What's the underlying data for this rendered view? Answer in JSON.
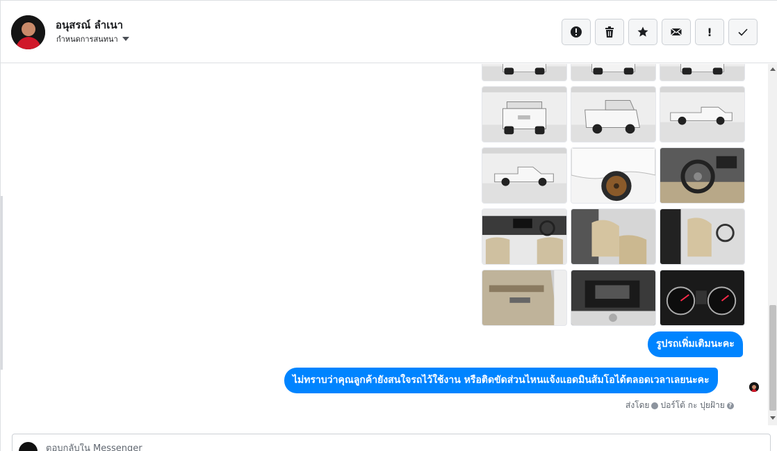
{
  "header": {
    "contact_name": "อนุสรณ์ ลำเนา",
    "assign_label": "กำหนดการสนทนา"
  },
  "toolbar": {
    "buttons": [
      {
        "icon": "alert-circle-icon",
        "label": ""
      },
      {
        "icon": "trash-icon",
        "label": ""
      },
      {
        "icon": "star-icon",
        "label": ""
      },
      {
        "icon": "envelope-icon",
        "label": ""
      },
      {
        "icon": "exclamation-icon",
        "label": "!"
      },
      {
        "icon": "checkmark-icon",
        "label": ""
      }
    ]
  },
  "thread": {
    "photos": [
      {
        "subject": "pickup-rear"
      },
      {
        "subject": "pickup-rear"
      },
      {
        "subject": "pickup-rear"
      },
      {
        "subject": "pickup-rear"
      },
      {
        "subject": "pickup-rear-quarter"
      },
      {
        "subject": "pickup-side-rear"
      },
      {
        "subject": "pickup-side"
      },
      {
        "subject": "wheel-closeup"
      },
      {
        "subject": "steering-wheel"
      },
      {
        "subject": "dashboard"
      },
      {
        "subject": "front-seats"
      },
      {
        "subject": "front-seats-side"
      },
      {
        "subject": "door-panel"
      },
      {
        "subject": "engine-bay"
      },
      {
        "subject": "gauge-cluster"
      }
    ],
    "messages": [
      {
        "text": "รูปรถเพิ่มเติมนะคะ"
      },
      {
        "text": "ไม่ทราบว่าคุณลูกค้ายังสนใจรถไว้ใช้งาน หรือติดขัดส่วนไหนแจ้งแอดมินส้มโอได้ตลอดเวลาเลยนะคะ"
      }
    ],
    "sent_by_prefix": "ส่งโดย",
    "sent_by_name": "ปอร์โต้ กะ ปุยฝ้าย"
  },
  "composer": {
    "placeholder": "ตอบกลับใน Messenger"
  },
  "colors": {
    "bubble": "#0084ff",
    "border": "#dddfe2",
    "button_bg": "#f5f6f7"
  }
}
